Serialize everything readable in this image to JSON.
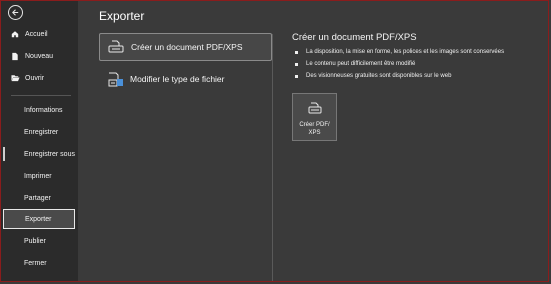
{
  "sidebar": {
    "items": [
      {
        "label": "Accueil",
        "icon": "home-icon"
      },
      {
        "label": "Nouveau",
        "icon": "new-document-icon"
      },
      {
        "label": "Ouvrir",
        "icon": "folder-open-icon"
      },
      {
        "label": "Informations"
      },
      {
        "label": "Enregistrer"
      },
      {
        "label": "Enregistrer sous"
      },
      {
        "label": "Imprimer"
      },
      {
        "label": "Partager"
      },
      {
        "label": "Exporter"
      },
      {
        "label": "Publier"
      },
      {
        "label": "Fermer"
      }
    ],
    "selected": "Exporter"
  },
  "main": {
    "title": "Exporter",
    "options": [
      {
        "label": "Créer un document PDF/XPS",
        "icon": "pdf-document-icon"
      },
      {
        "label": "Modifier le type de fichier",
        "icon": "change-file-type-icon"
      }
    ]
  },
  "detail": {
    "title": "Créer un document PDF/XPS",
    "bullets": [
      "La disposition, la mise en forme, les polices et les images sont conservées",
      "Le contenu peut difficilement être modifié",
      "Des visionneuses gratuites sont disponibles sur le web"
    ],
    "button_label": "Créer PDF/\nXPS"
  },
  "colors": {
    "sidebar_bg": "#2b2b2b",
    "main_bg": "#3a3a3a",
    "border_accent": "#8a1c1c"
  }
}
